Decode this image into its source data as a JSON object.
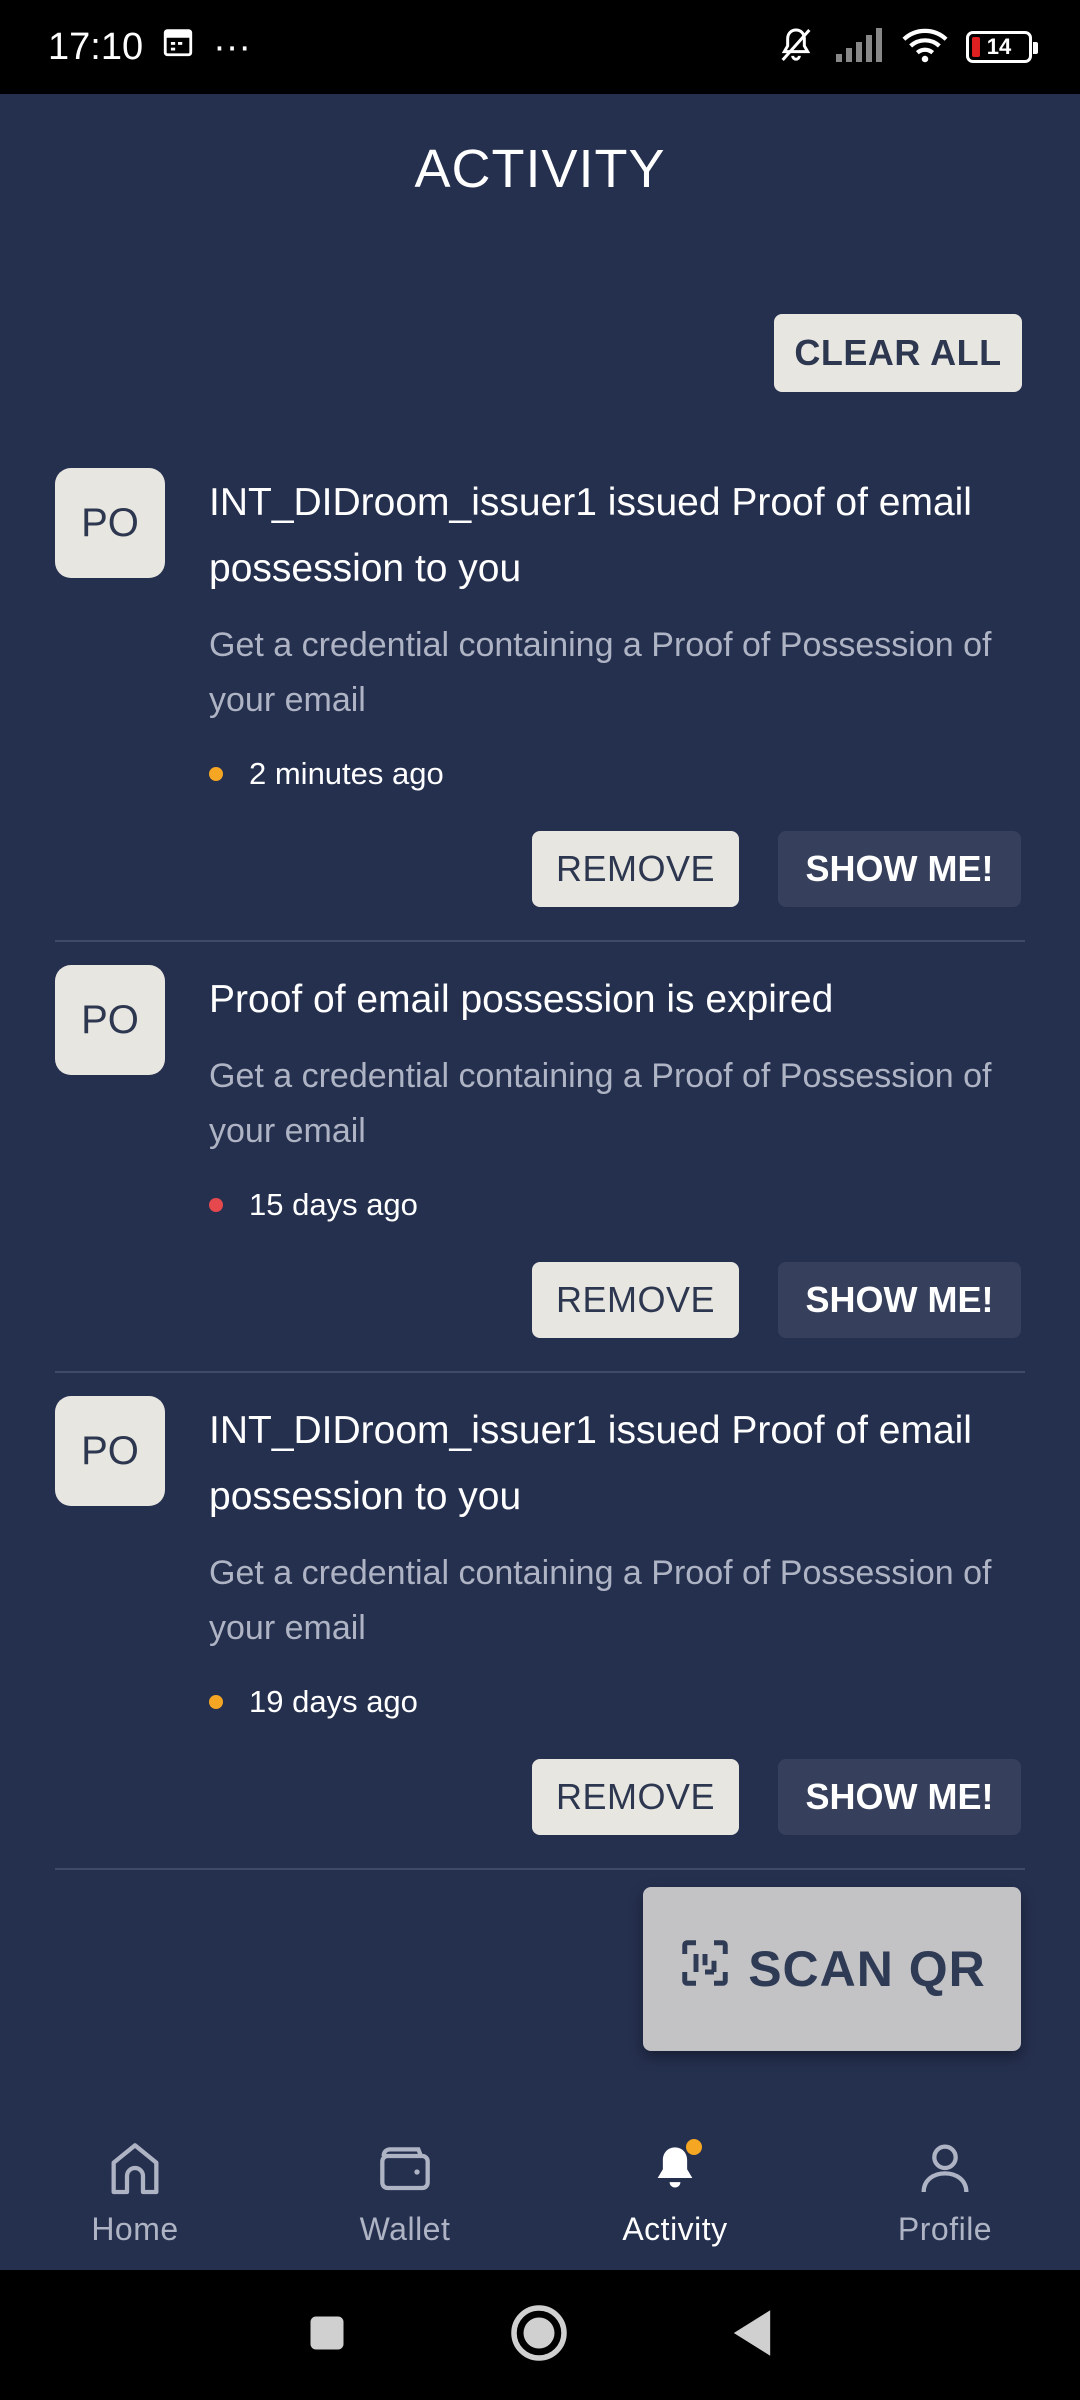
{
  "status_bar": {
    "time": "17:10",
    "more": "···",
    "battery": "14"
  },
  "page": {
    "title": "ACTIVITY"
  },
  "actions": {
    "clear_all": "CLEAR ALL"
  },
  "notifications": [
    {
      "avatar": "PO",
      "title": "INT_DIDroom_issuer1 issued Proof of email possession to you",
      "description": "Get a credential containing a Proof of Possession of your email",
      "time": "2 minutes ago",
      "dot_color": "#f5a623",
      "remove_label": "REMOVE",
      "show_label": "SHOW ME!"
    },
    {
      "avatar": "PO",
      "title": "Proof of email possession is expired",
      "description": "Get a credential containing a Proof of Possession of your email",
      "time": "15 days ago",
      "dot_color": "#e5484d",
      "remove_label": "REMOVE",
      "show_label": "SHOW ME!"
    },
    {
      "avatar": "PO",
      "title": "INT_DIDroom_issuer1 issued Proof of email possession to you",
      "description": "Get a credential containing a Proof of Possession of your email",
      "time": "19 days ago",
      "dot_color": "#f5a623",
      "remove_label": "REMOVE",
      "show_label": "SHOW ME!"
    }
  ],
  "scan_qr": {
    "label": "SCAN QR"
  },
  "bottom_nav": [
    {
      "label": "Home",
      "icon": "home-icon"
    },
    {
      "label": "Wallet",
      "icon": "wallet-icon"
    },
    {
      "label": "Activity",
      "icon": "bell-icon",
      "active": true
    },
    {
      "label": "Profile",
      "icon": "person-icon"
    }
  ],
  "colors": {
    "background": "#25304f",
    "button_light": "#e8e6e1",
    "button_dark": "#36405c",
    "accent_orange": "#f5a623",
    "accent_red": "#e5484d"
  }
}
